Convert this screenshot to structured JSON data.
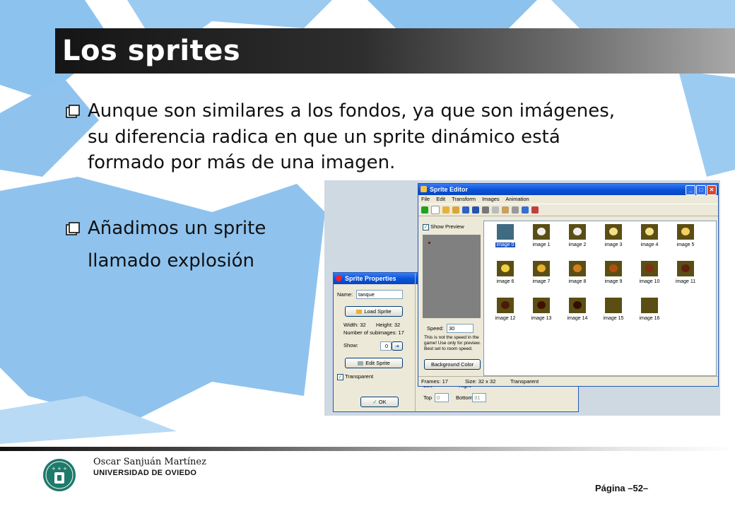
{
  "slide": {
    "title": "Los sprites",
    "bullets": [
      {
        "lines": [
          "Aunque son similares a los fondos, ya que son imágenes,",
          "su diferencia radica en que un sprite dinámico está",
          "formado por más de una imagen."
        ]
      },
      {
        "lines": [
          "Añadimos un sprite",
          "llamado explosión"
        ]
      }
    ]
  },
  "sprite_editor": {
    "title": "Sprite Editor",
    "menu": [
      "File",
      "Edit",
      "Transform",
      "Images",
      "Animation"
    ],
    "show_preview": "Show Preview",
    "speed_label": "Speed:",
    "speed_value": "30",
    "speed_note": [
      "This is not the speed in the",
      "game! Use only for preview.",
      "Best set to room speed."
    ],
    "bg_color_button": "Background Color",
    "images": [
      "image 0",
      "image 1",
      "image 2",
      "image 3",
      "image 4",
      "image 5",
      "image 6",
      "image 7",
      "image 8",
      "image 9",
      "image 10",
      "image 11",
      "image 12",
      "image 13",
      "image 14",
      "image 15",
      "image 16"
    ],
    "status": {
      "frames": "Frames: 17",
      "size": "Size: 32 x 32",
      "transparent": "Transparent"
    }
  },
  "sprite_properties": {
    "title": "Sprite Properties",
    "name_label": "Name:",
    "name_value": "tanque",
    "load_button": "Load Sprite",
    "width": "Width: 32",
    "height": "Height: 32",
    "subimages": "Number of subimages: 17",
    "show_label": "Show:",
    "show_value": "0",
    "edit_button": "Edit Sprite",
    "transparent": "Transparent",
    "ok_button": "OK",
    "bbox": {
      "left": "Left",
      "right": "Right",
      "top": "Top",
      "top_value": "0",
      "bottom": "Bottom",
      "bottom_value": "31"
    }
  },
  "footer": {
    "author": "Oscar Sanjuán Martínez",
    "university": "UNIVERSIDAD DE OVIEDO",
    "page": "Página –52–"
  },
  "colors": {
    "title_bar": "#151515",
    "bg_blue": "#8fc3ee",
    "xp_title": "#0a55d8"
  }
}
